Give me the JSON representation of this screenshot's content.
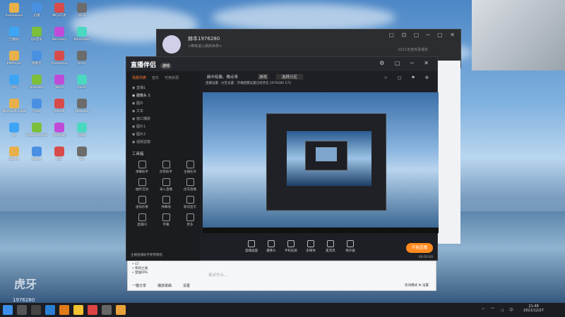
{
  "desktop": {
    "icons": [
      {
        "label": "Audiowave"
      },
      {
        "label": "迅雷"
      },
      {
        "label": "MCU工具"
      },
      {
        "label": "ISCSI"
      },
      {
        "label": "回收站"
      },
      {
        "label": "QQ音乐"
      },
      {
        "label": "Recovery"
      },
      {
        "label": "WinLocker"
      },
      {
        "label": "KMPlayer"
      },
      {
        "label": "网易云"
      },
      {
        "label": "Photoshop"
      },
      {
        "label": "Unity"
      },
      {
        "label": "QQ"
      },
      {
        "label": "Snipaste"
      },
      {
        "label": "Word"
      },
      {
        "label": "Excel"
      },
      {
        "label": "Microsoft Edge"
      },
      {
        "label": "Trust"
      },
      {
        "label": "Jirasoft"
      },
      {
        "label": "Notepad"
      },
      {
        "label": "IE"
      },
      {
        "label": "Visual Studio"
      },
      {
        "label": "Foxmail"
      },
      {
        "label": "OBS"
      },
      {
        "label": "Weixin"
      },
      {
        "label": "Steam"
      },
      {
        "label": "PDF"
      },
      {
        "label": "Git"
      }
    ],
    "overlay_logo": "虎牙",
    "overlay_id": "1976280"
  },
  "chat_window": {
    "username": "赫本1976280",
    "signature": "<带你进入新的世界>",
    "date_text": "2021年度热录播单",
    "controls": "▢ ⊡ ▢ ─ ▢ ✕"
  },
  "main_window": {
    "brand": "直播伴侣",
    "brand_badge": "游戏",
    "title_controls": "⚙ ▢ ─ ✕",
    "tabs": [
      {
        "label": "场景列表",
        "active": true
      },
      {
        "label": "音乐",
        "active": false
      },
      {
        "label": "可用资源",
        "active": false
      }
    ],
    "scenes": [
      {
        "label": "直播1",
        "active": false
      },
      {
        "label": "摄像头 1",
        "active": true
      },
      {
        "label": "图片",
        "active": false
      },
      {
        "label": "文本",
        "active": false
      },
      {
        "label": "窗口捕获",
        "active": false
      },
      {
        "label": "图片1",
        "active": false
      },
      {
        "label": "图片2",
        "active": false
      },
      {
        "label": "视频滤镜",
        "active": false
      }
    ],
    "toolbox_title": "工具箱",
    "tools": [
      {
        "label": "弹幕助手"
      },
      {
        "label": "房管助手"
      },
      {
        "label": "主播任务"
      },
      {
        "label": "抽奖活动"
      },
      {
        "label": "录入直播"
      },
      {
        "label": "虎牙直播"
      },
      {
        "label": "虚拟形象"
      },
      {
        "label": "弹幕墙"
      },
      {
        "label": "歌词显示"
      },
      {
        "label": "直播间"
      },
      {
        "label": "字幕"
      },
      {
        "label": "更多"
      }
    ],
    "notice": "主播直播助手使用教程",
    "room_title": "赫中有像、晚点来",
    "category": "游戏",
    "area_button": "选择分区",
    "subline": "直播设置 · 分区设置 · 开播提醒设置已经开启  1976280  272",
    "top_icons": "☆ ▢ ⚑ ⚙",
    "bottom_items": [
      {
        "label": "直播画面"
      },
      {
        "label": "摄像头"
      },
      {
        "label": "手机投屏"
      },
      {
        "label": "多媒体"
      },
      {
        "label": "麦克风"
      },
      {
        "label": "扬声器"
      }
    ],
    "go_live": "开始直播",
    "timer": "00:00:00"
  },
  "chat_input": {
    "users": [
      "CF",
      "和风之城",
      "楚国RPG"
    ],
    "placeholder": "说点什么...",
    "bottom_left": [
      "一键分享",
      "播放歌曲",
      "设置"
    ],
    "bottom_right": "房间模式  ⚙  设置"
  },
  "taskbar": {
    "time": "21:48",
    "date": "2021/12/27",
    "tray": "^ ⌒ ◁ 中"
  }
}
